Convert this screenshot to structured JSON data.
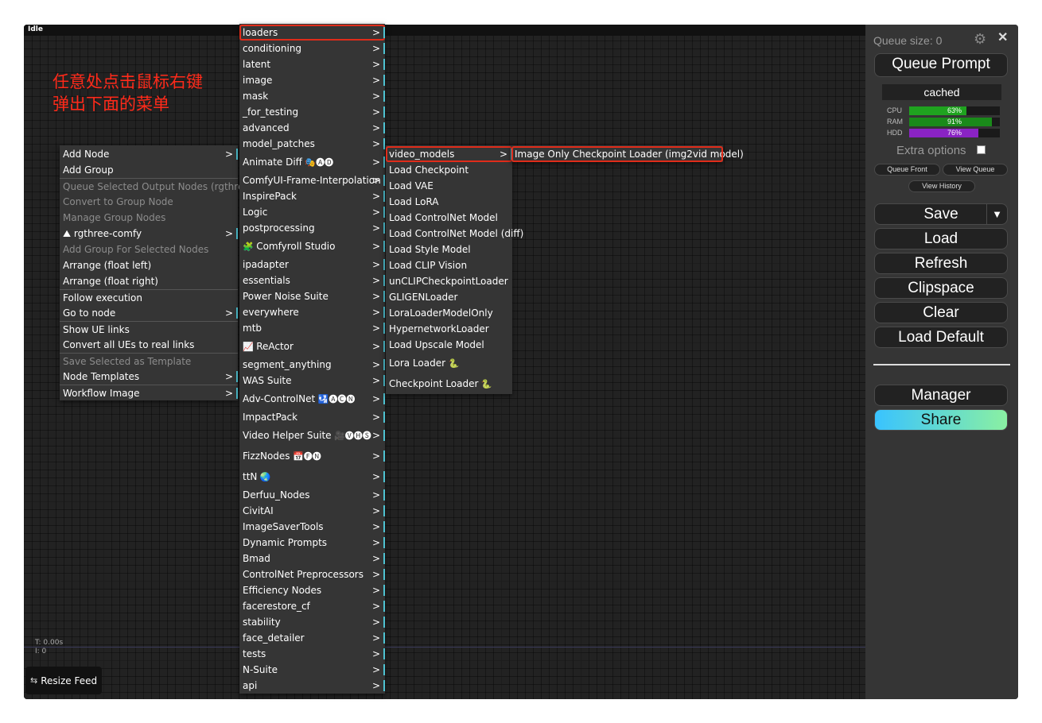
{
  "canvas": {
    "status": "Idle",
    "annotation": "任意处点击鼠标右键\n弹出下面的菜单",
    "stats": {
      "time": "T: 0.00s",
      "iterations": "I: 0"
    },
    "resize_feed": {
      "icon": "resize-icon",
      "label": "Resize Feed"
    }
  },
  "context_menu": {
    "items": [
      {
        "label": "Add Node",
        "submenu": true
      },
      {
        "label": "Add Group"
      },
      {
        "label": "Queue Selected Output Nodes (rgthree)",
        "disabled": true
      },
      {
        "label": "Convert to Group Node",
        "disabled": true
      },
      {
        "label": "Manage Group Nodes",
        "disabled": true
      },
      {
        "label": "rgthree-comfy",
        "icon": "rgthree-icon",
        "submenu": true
      },
      {
        "label": "Add Group For Selected Nodes",
        "disabled": true
      },
      {
        "label": "Arrange (float left)"
      },
      {
        "label": "Arrange (float right)"
      },
      {
        "label": "Follow execution"
      },
      {
        "label": "Go to node",
        "submenu": true
      },
      {
        "label": "Show UE links"
      },
      {
        "label": "Convert all UEs to real links"
      },
      {
        "label": "Save Selected as Template",
        "disabled": true
      },
      {
        "label": "Node Templates",
        "submenu": true
      },
      {
        "label": "Workflow Image",
        "submenu": true
      }
    ]
  },
  "category_menu": {
    "items": [
      {
        "label": "loaders",
        "highlight": true
      },
      {
        "label": "conditioning"
      },
      {
        "label": "latent"
      },
      {
        "label": "image"
      },
      {
        "label": "mask"
      },
      {
        "label": "_for_testing"
      },
      {
        "label": "advanced"
      },
      {
        "label": "model_patches"
      },
      {
        "label": "Animate Diff",
        "suffix": "🎭🅐🅓"
      },
      {
        "label": "ComfyUI-Frame-Interpolation"
      },
      {
        "label": "InspirePack"
      },
      {
        "label": "Logic"
      },
      {
        "label": "postprocessing"
      },
      {
        "label": "Comfyroll Studio",
        "prefix": "🧩"
      },
      {
        "label": "ipadapter"
      },
      {
        "label": "essentials"
      },
      {
        "label": "Power Noise Suite"
      },
      {
        "label": "everywhere"
      },
      {
        "label": "mtb"
      },
      {
        "label": "ReActor",
        "prefix": "📈"
      },
      {
        "label": "segment_anything"
      },
      {
        "label": "WAS Suite"
      },
      {
        "label": "Adv-ControlNet",
        "suffix": "🛂🅐🅒🅝"
      },
      {
        "label": "ImpactPack"
      },
      {
        "label": "Video Helper Suite",
        "suffix": "🎥🅥🅗🅢"
      },
      {
        "label": "FizzNodes",
        "suffix": "📅🅕🅝"
      },
      {
        "label": "ttN",
        "suffix": "🌏"
      },
      {
        "label": "Derfuu_Nodes"
      },
      {
        "label": "CivitAI"
      },
      {
        "label": "ImageSaverTools"
      },
      {
        "label": "Dynamic Prompts"
      },
      {
        "label": "Bmad"
      },
      {
        "label": "ControlNet Preprocessors"
      },
      {
        "label": "Efficiency Nodes"
      },
      {
        "label": "facerestore_cf"
      },
      {
        "label": "stability"
      },
      {
        "label": "face_detailer"
      },
      {
        "label": "tests"
      },
      {
        "label": "N-Suite"
      },
      {
        "label": "api"
      }
    ]
  },
  "loaders_menu": {
    "items": [
      {
        "label": "video_models",
        "submenu": true,
        "highlight": true
      },
      {
        "label": "Load Checkpoint"
      },
      {
        "label": "Load VAE"
      },
      {
        "label": "Load LoRA"
      },
      {
        "label": "Load ControlNet Model"
      },
      {
        "label": "Load ControlNet Model (diff)"
      },
      {
        "label": "Load Style Model"
      },
      {
        "label": "Load CLIP Vision"
      },
      {
        "label": "unCLIPCheckpointLoader"
      },
      {
        "label": "GLIGENLoader"
      },
      {
        "label": "LoraLoaderModelOnly"
      },
      {
        "label": "HypernetworkLoader"
      },
      {
        "label": "Load Upscale Model"
      },
      {
        "label": "Lora Loader",
        "suffix": "🐍"
      },
      {
        "label": "Checkpoint Loader",
        "suffix": "🐍"
      }
    ]
  },
  "video_models_menu": {
    "items": [
      {
        "label": "Image Only Checkpoint Loader (img2vid model)",
        "highlight": true
      }
    ]
  },
  "side_panel": {
    "queue_size": "Queue size: 0",
    "queue_prompt": "Queue Prompt",
    "cached": "cached",
    "resources": [
      {
        "label": "CPU",
        "value": 63,
        "display": "63%",
        "color": "#1fa31f"
      },
      {
        "label": "RAM",
        "value": 91,
        "display": "91%",
        "color": "#1a8a1a"
      },
      {
        "label": "HDD",
        "value": 76,
        "display": "76%",
        "color": "#8a23c4"
      }
    ],
    "extra_options": "Extra options",
    "queue_front": "Queue Front",
    "view_queue": "View Queue",
    "view_history": "View History",
    "save": "Save",
    "save_caret": "▼",
    "load": "Load",
    "refresh": "Refresh",
    "clipspace": "Clipspace",
    "clear": "Clear",
    "load_default": "Load Default",
    "manager": "Manager",
    "share": "Share"
  }
}
